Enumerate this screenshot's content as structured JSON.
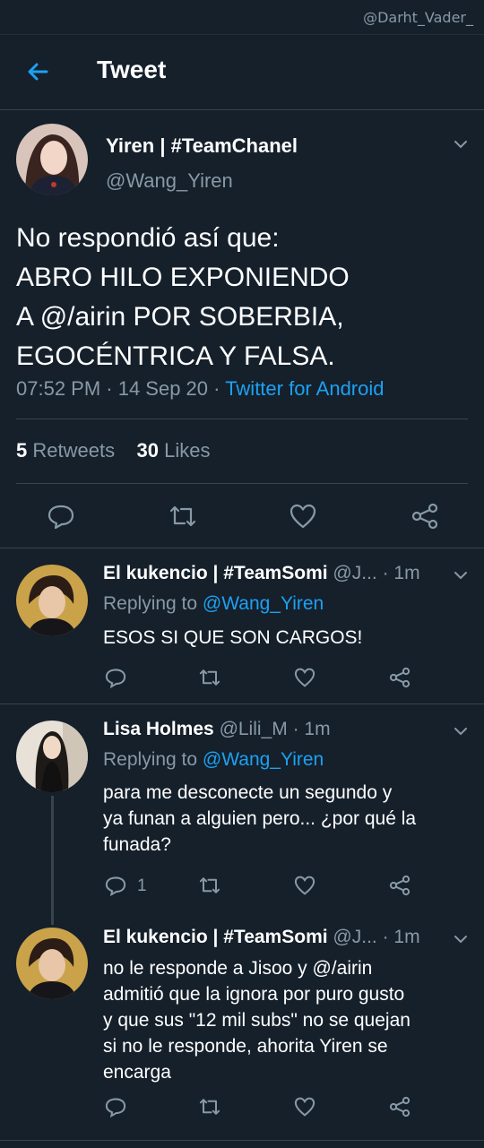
{
  "watermark": "@Darht_Vader_",
  "header": {
    "title": "Tweet"
  },
  "main_tweet": {
    "name": "Yiren | #TeamChanel",
    "handle": "@Wang_Yiren",
    "text_lines": [
      "No respondió así que:",
      "ABRO HILO EXPONIENDO",
      "A @/airin POR SOBERBIA,",
      "EGOCÉNTRICA Y FALSA."
    ],
    "time": "07:52 PM · 14 Sep 20 · ",
    "source": "Twitter for Android",
    "retweets_count": "5",
    "retweets_label": "Retweets",
    "likes_count": "30",
    "likes_label": "Likes"
  },
  "replies": [
    {
      "name": "El kukencio | #TeamSomi",
      "handle": "@J...",
      "time": "· 1m",
      "replying_prefix": "Replying to ",
      "replying_to": "@Wang_Yiren",
      "text": "ESOS SI QUE SON CARGOS!",
      "reply_count": ""
    },
    {
      "name": "Lisa Holmes",
      "handle": "@Lili_M",
      "time": "· 1m",
      "replying_prefix": "Replying to ",
      "replying_to": "@Wang_Yiren",
      "text_lines": [
        "para me desconecte un segundo y",
        "ya funan a alguien pero... ¿por qué la",
        "funada?"
      ],
      "reply_count": "1"
    },
    {
      "name": "El kukencio | #TeamSomi",
      "handle": "@J...",
      "time": "· 1m",
      "text_lines": [
        "no le responde a Jisoo y @/airin",
        "admitió que la ignora por puro gusto",
        "y que sus \"12 mil subs\" no se quejan",
        "si no le responde, ahorita Yiren se",
        "encarga"
      ],
      "reply_count": ""
    }
  ],
  "colors": {
    "background": "#15202b",
    "accent": "#1da1f2",
    "muted": "#8899a6",
    "divider": "#38444d"
  },
  "icons": [
    "arrow-left-icon",
    "chevron-down-icon",
    "reply-icon",
    "retweet-icon",
    "heart-icon",
    "share-icon"
  ]
}
